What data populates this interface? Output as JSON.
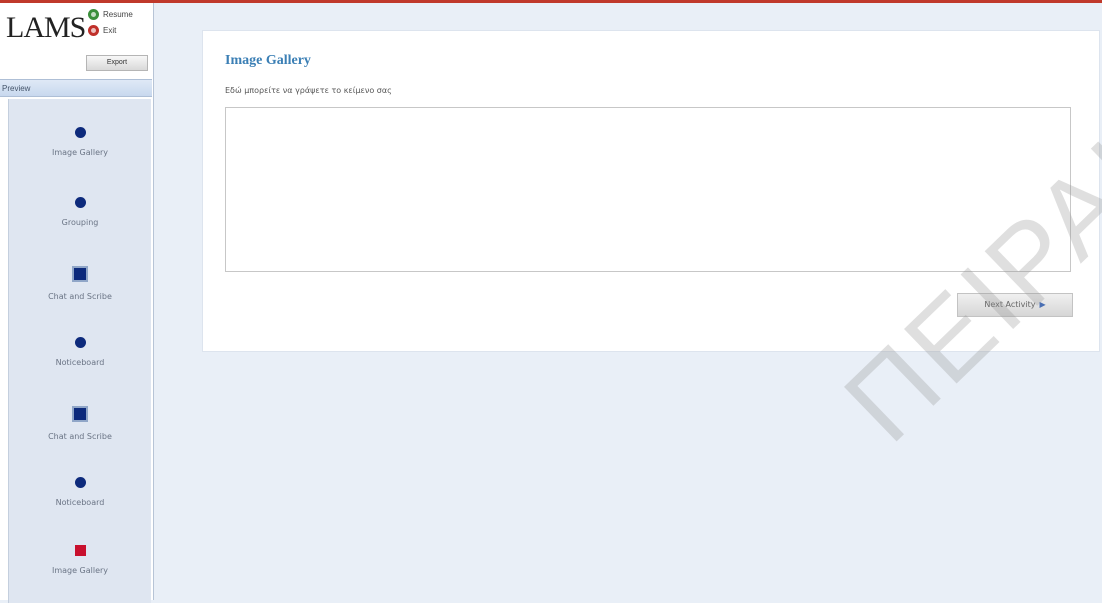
{
  "app": {
    "brand": "LAMS",
    "resume_label": "Resume",
    "exit_label": "Exit",
    "export_label": "Export"
  },
  "sidebar": {
    "header": "Preview",
    "activities": [
      {
        "label": "Image Gallery",
        "marker": "circle"
      },
      {
        "label": "Grouping",
        "marker": "circle"
      },
      {
        "label": "Chat and Scribe",
        "marker": "square"
      },
      {
        "label": "Noticeboard",
        "marker": "circle"
      },
      {
        "label": "Chat and Scribe",
        "marker": "square"
      },
      {
        "label": "Noticeboard",
        "marker": "circle"
      },
      {
        "label": "Image Gallery",
        "marker": "red-square"
      }
    ]
  },
  "main": {
    "title": "Image Gallery",
    "instruction": "Εδώ μπορείτε να γράψετε το κείμενο σας",
    "textarea_value": "",
    "next_button": "Next Activity"
  },
  "watermark": "ΠΕΙΡΑΙΑ",
  "colors": {
    "accent_blue": "#3b7fb5",
    "marker_blue": "#0d2a7c",
    "marker_red": "#c8102e",
    "top_border": "#c0392b"
  }
}
